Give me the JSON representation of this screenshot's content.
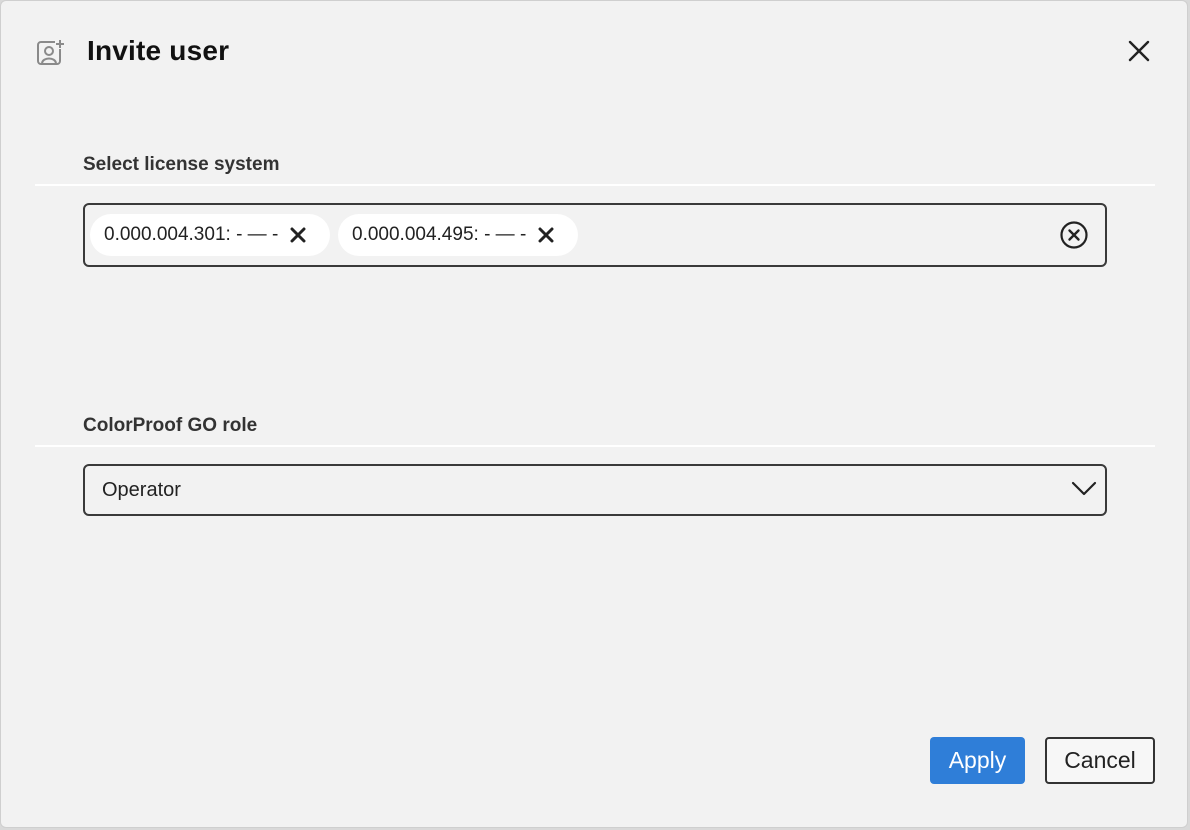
{
  "dialog": {
    "title": "Invite user",
    "header_icon": "add-user-icon",
    "close_icon": "close-icon"
  },
  "license_section": {
    "label": "Select license system",
    "selected": [
      {
        "label": "0.000.004.301: - — -",
        "remove_icon": "close-icon"
      },
      {
        "label": "0.000.004.495: - — -",
        "remove_icon": "close-icon"
      }
    ],
    "clear_icon": "circle-x-icon"
  },
  "role_section": {
    "label": "ColorProof GO role",
    "selected_value": "Operator",
    "dropdown_icon": "chevron-down-icon"
  },
  "actions": {
    "apply_label": "Apply",
    "cancel_label": "Cancel"
  },
  "colors": {
    "accent": "#2f7ed8",
    "background": "#f2f2f2",
    "border": "#3a3a3a"
  }
}
